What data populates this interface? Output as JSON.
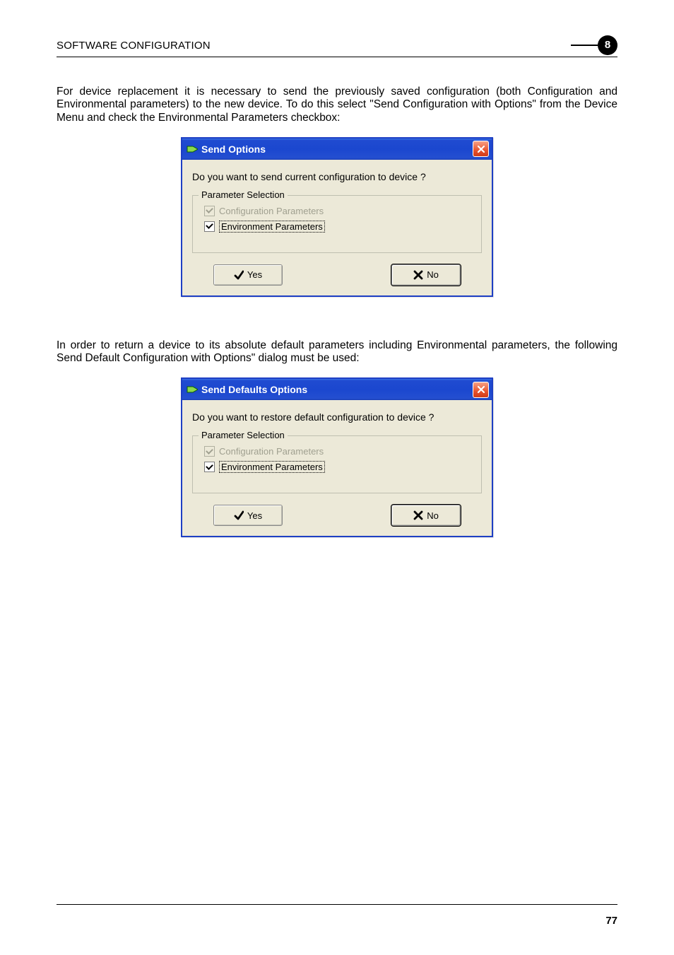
{
  "header": {
    "title": "SOFTWARE CONFIGURATION",
    "chapter": "8"
  },
  "para1": "For device replacement it is necessary to send the previously saved configuration (both Configuration and Environmental parameters) to the new device. To do this select \"Send Configuration with Options\" from the Device Menu and check the Environmental Parameters checkbox:",
  "dialog1": {
    "title": "Send Options",
    "question": "Do you want to send current configuration to device ?",
    "group_label": "Parameter Selection",
    "chk_config": "Configuration Parameters",
    "chk_env": "Environment Parameters",
    "yes": "Yes",
    "no": "No"
  },
  "para2": "In order to return a device to its absolute default parameters including Environmental parameters, the following Send Default Configuration with Options\" dialog must be used:",
  "dialog2": {
    "title": "Send Defaults Options",
    "question": "Do you want to restore default configuration to device ?",
    "group_label": "Parameter Selection",
    "chk_config": "Configuration Parameters",
    "chk_env": "Environment Parameters",
    "yes": "Yes",
    "no": "No"
  },
  "page_number": "77"
}
